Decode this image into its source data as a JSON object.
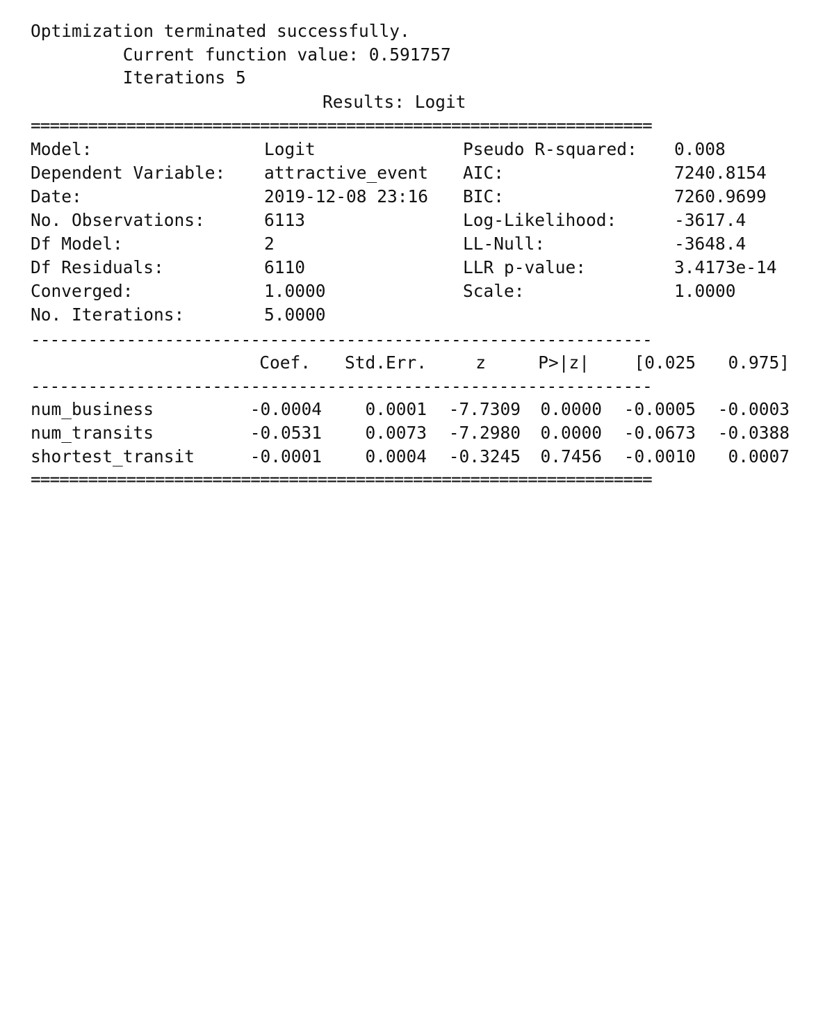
{
  "header": {
    "status": "Optimization terminated successfully.",
    "function_value_line": "         Current function value: 0.591757",
    "iterations_line": "         Iterations 5",
    "title": "Results: Logit"
  },
  "rules": {
    "double": "=================================================================",
    "single": "-----------------------------------------------------------------"
  },
  "summary": {
    "left": [
      {
        "label": "Model:",
        "value": "Logit"
      },
      {
        "label": "Dependent Variable:",
        "value": "attractive_event"
      },
      {
        "label": "Date:",
        "value": "2019-12-08 23:16"
      },
      {
        "label": "No. Observations:",
        "value": "6113"
      },
      {
        "label": "Df Model:",
        "value": "2"
      },
      {
        "label": "Df Residuals:",
        "value": "6110"
      },
      {
        "label": "Converged:",
        "value": "1.0000"
      },
      {
        "label": "No. Iterations:",
        "value": "5.0000"
      }
    ],
    "right": [
      {
        "label": "Pseudo R-squared:",
        "value": "0.008"
      },
      {
        "label": "AIC:",
        "value": "7240.8154"
      },
      {
        "label": "BIC:",
        "value": "7260.9699"
      },
      {
        "label": "Log-Likelihood:",
        "value": "-3617.4"
      },
      {
        "label": "LL-Null:",
        "value": "-3648.4"
      },
      {
        "label": "LLR p-value:",
        "value": "3.4173e-14"
      },
      {
        "label": "Scale:",
        "value": "1.0000"
      }
    ]
  },
  "coef_table": {
    "columns": [
      "Coef.",
      "Std.Err.",
      "z",
      "P>|z|",
      "[0.025",
      "0.975]"
    ],
    "rows": [
      {
        "name": "num_business",
        "values": [
          "-0.0004",
          "0.0001",
          "-7.7309",
          "0.0000",
          "-0.0005",
          "-0.0003"
        ]
      },
      {
        "name": "num_transits",
        "values": [
          "-0.0531",
          "0.0073",
          "-7.2980",
          "0.0000",
          "-0.0673",
          "-0.0388"
        ]
      },
      {
        "name": "shortest_transit",
        "values": [
          "-0.0001",
          "0.0004",
          "-0.3245",
          "0.7456",
          "-0.0010",
          "0.0007"
        ]
      }
    ]
  }
}
